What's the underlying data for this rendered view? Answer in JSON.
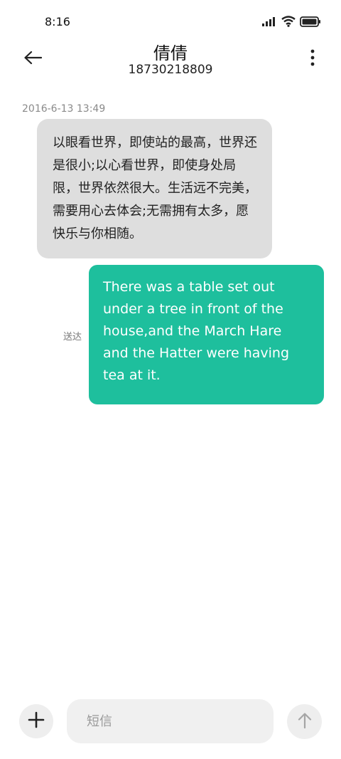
{
  "status_bar": {
    "time": "8:16",
    "icons": [
      "signal-icon",
      "wifi-icon",
      "battery-icon"
    ]
  },
  "header": {
    "contact_name": "倩倩",
    "contact_number": "18730218809",
    "back_icon": "back-arrow-icon",
    "more_icon": "more-vertical-icon"
  },
  "messages": [
    {
      "timestamp": "2016-6-13 13:49",
      "direction": "incoming",
      "text": "以眼看世界，即使站的最高，世界还是很小;以心看世界，即使身处局限，世界依然很大。生活远不完美，需要用心去体会;无需拥有太多，愿快乐与你相随。"
    },
    {
      "direction": "outgoing",
      "status": "送达",
      "text": "There was a table set out under a tree in front of the house,and the March Hare and the Hatter were having tea at it."
    }
  ],
  "input_bar": {
    "placeholder": "短信",
    "value": "",
    "add_icon": "plus-icon",
    "send_icon": "arrow-up-icon"
  },
  "colors": {
    "outgoing_bubble": "#1ebf9d",
    "incoming_bubble": "#dedede",
    "background": "#ffffff"
  }
}
